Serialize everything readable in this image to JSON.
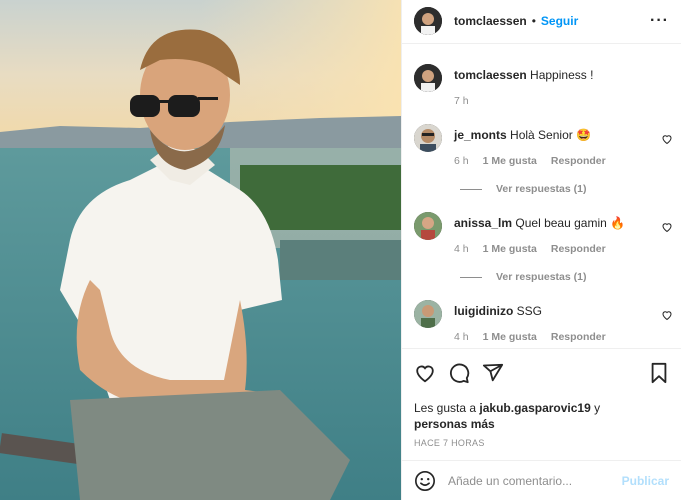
{
  "header": {
    "username": "tomclaessen",
    "separator": "•",
    "follow_label": "Seguir",
    "more_icon": "ellipsis-icon",
    "more_glyph": "···"
  },
  "caption": {
    "username": "tomclaessen",
    "text": "Happiness !",
    "time": "7 h"
  },
  "comments": [
    {
      "username": "je_monts",
      "text": "Holà Senior 🤩",
      "time": "6 h",
      "likes": "1 Me gusta",
      "reply": "Responder",
      "view_replies": "Ver respuestas (1)"
    },
    {
      "username": "anissa_lm",
      "text": "Quel beau gamin 🔥",
      "time": "4 h",
      "likes": "1 Me gusta",
      "reply": "Responder",
      "view_replies": "Ver respuestas (1)"
    },
    {
      "username": "luigidinizo",
      "text": "SSG",
      "time": "4 h",
      "likes": "1 Me gusta",
      "reply": "Responder"
    }
  ],
  "actions": {
    "icons": [
      "heart-icon",
      "comment-icon",
      "share-icon",
      "bookmark-icon"
    ]
  },
  "likes": {
    "prefix": "Les gusta a",
    "user": "jakub.gasparovic19",
    "connector": "y",
    "suffix": "personas más"
  },
  "timestamp": "HACE 7 HORAS",
  "add_comment": {
    "placeholder": "Añade un comentario...",
    "emoji_icon": "smiley-icon",
    "publish_label": "Publicar"
  },
  "colors": {
    "accent": "#0095f6",
    "publish_disabled": "#b2dffc",
    "meta": "#8e8e8e",
    "text": "#262626"
  }
}
